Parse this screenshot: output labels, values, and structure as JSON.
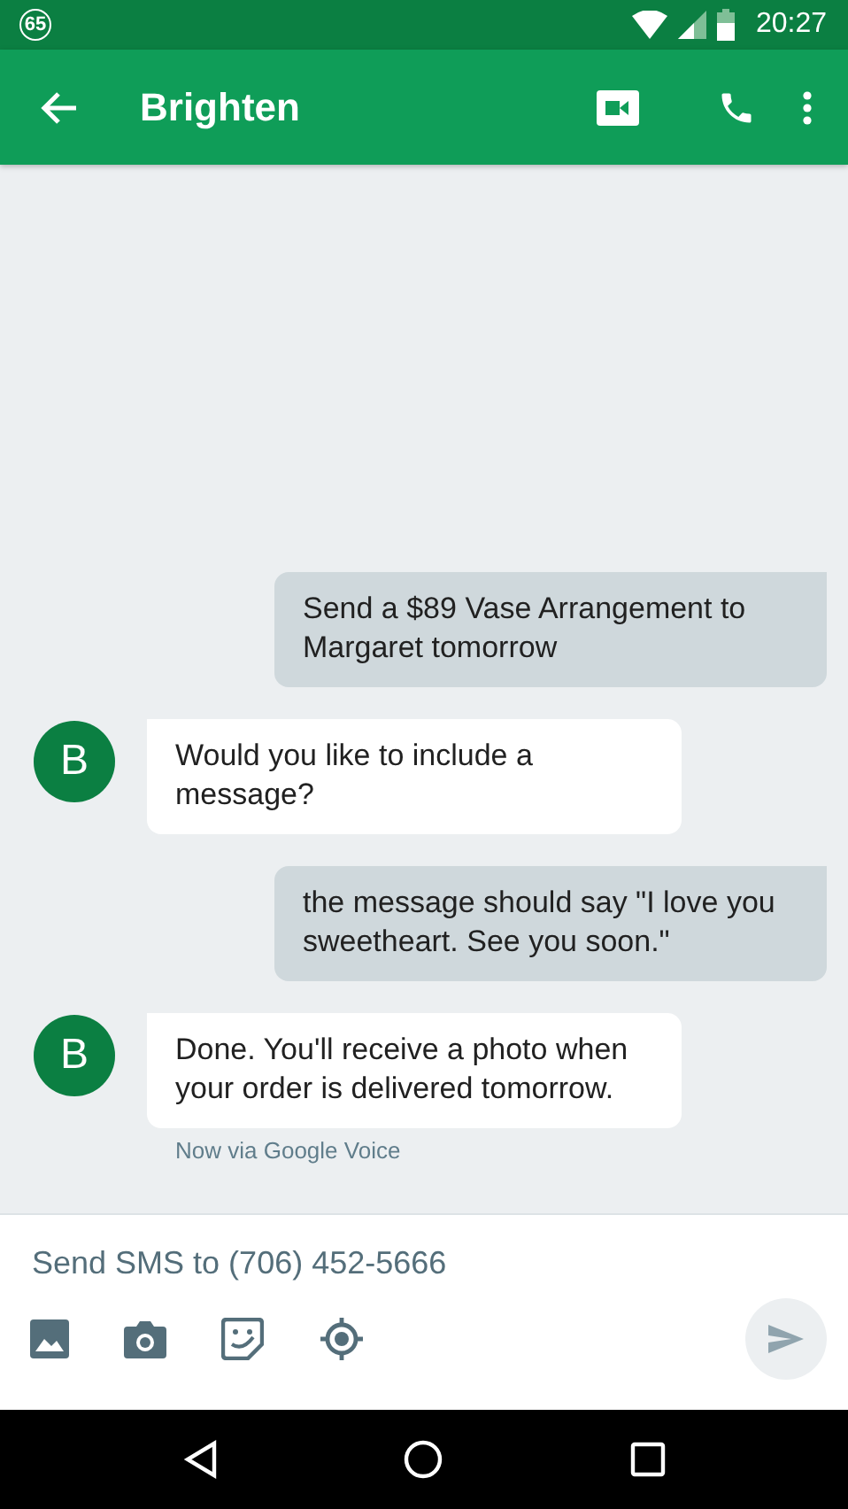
{
  "status_bar": {
    "badge": "65",
    "time": "20:27"
  },
  "app_bar": {
    "title": "Brighten"
  },
  "messages": [
    {
      "kind": "outgoing",
      "text": "Send a $89 Vase Arrangement to Margaret tomorrow"
    },
    {
      "kind": "incoming",
      "avatar": "B",
      "text": "Would you like to include a message?"
    },
    {
      "kind": "outgoing",
      "text": "the message should say \"I love you sweetheart. See you soon.\""
    },
    {
      "kind": "incoming",
      "avatar": "B",
      "text": "Done. You'll receive a photo when your order is delivered tomorrow.",
      "meta": "Now via Google Voice"
    }
  ],
  "compose": {
    "placeholder": "Send SMS to (706) 452-5666"
  }
}
